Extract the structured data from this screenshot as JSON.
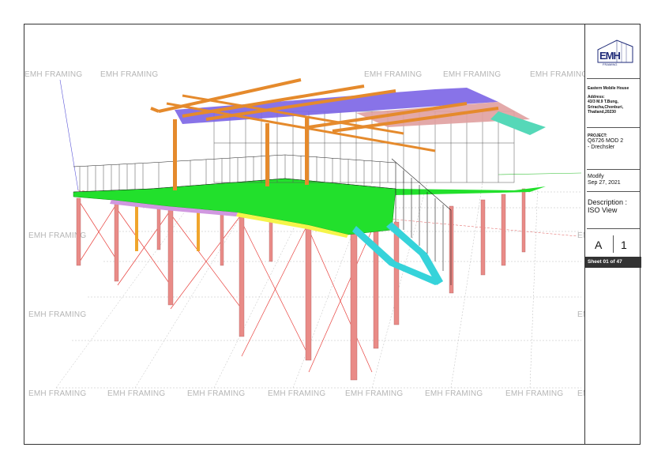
{
  "watermark": "EMH FRAMING",
  "title_block": {
    "logo_text": "EMH",
    "logo_sub": "FRAMING",
    "client_name": "Eastern Mobile House",
    "address_label": "Address:",
    "address_lines": [
      "43/3 M.9 T.Bung,",
      "Sriracha,Chonburi,",
      "Thailand,20230"
    ],
    "project_label": "PROJECT:",
    "project_lines": [
      "Q6726 MOD 2",
      "- Drechsler"
    ],
    "modify_label": "Modify",
    "modify_date": "Sep 27, 2021",
    "description_label": "Description :",
    "description_value": "ISO View",
    "sheet_size": "A",
    "revision": "1",
    "sheet_number": "Sheet 01 of 47"
  },
  "colors": {
    "border": "#333333",
    "watermark": "#b5b5b5",
    "logo": "#1e2a78",
    "post": "#e98b87",
    "floor_green": "#22e02c",
    "rafter_orange": "#e58a2c",
    "purlin_purple": "#7b64e6",
    "stair_cyan": "#36d3da",
    "rail_black": "#1a1a1a",
    "brace_red": "#e8403c"
  }
}
